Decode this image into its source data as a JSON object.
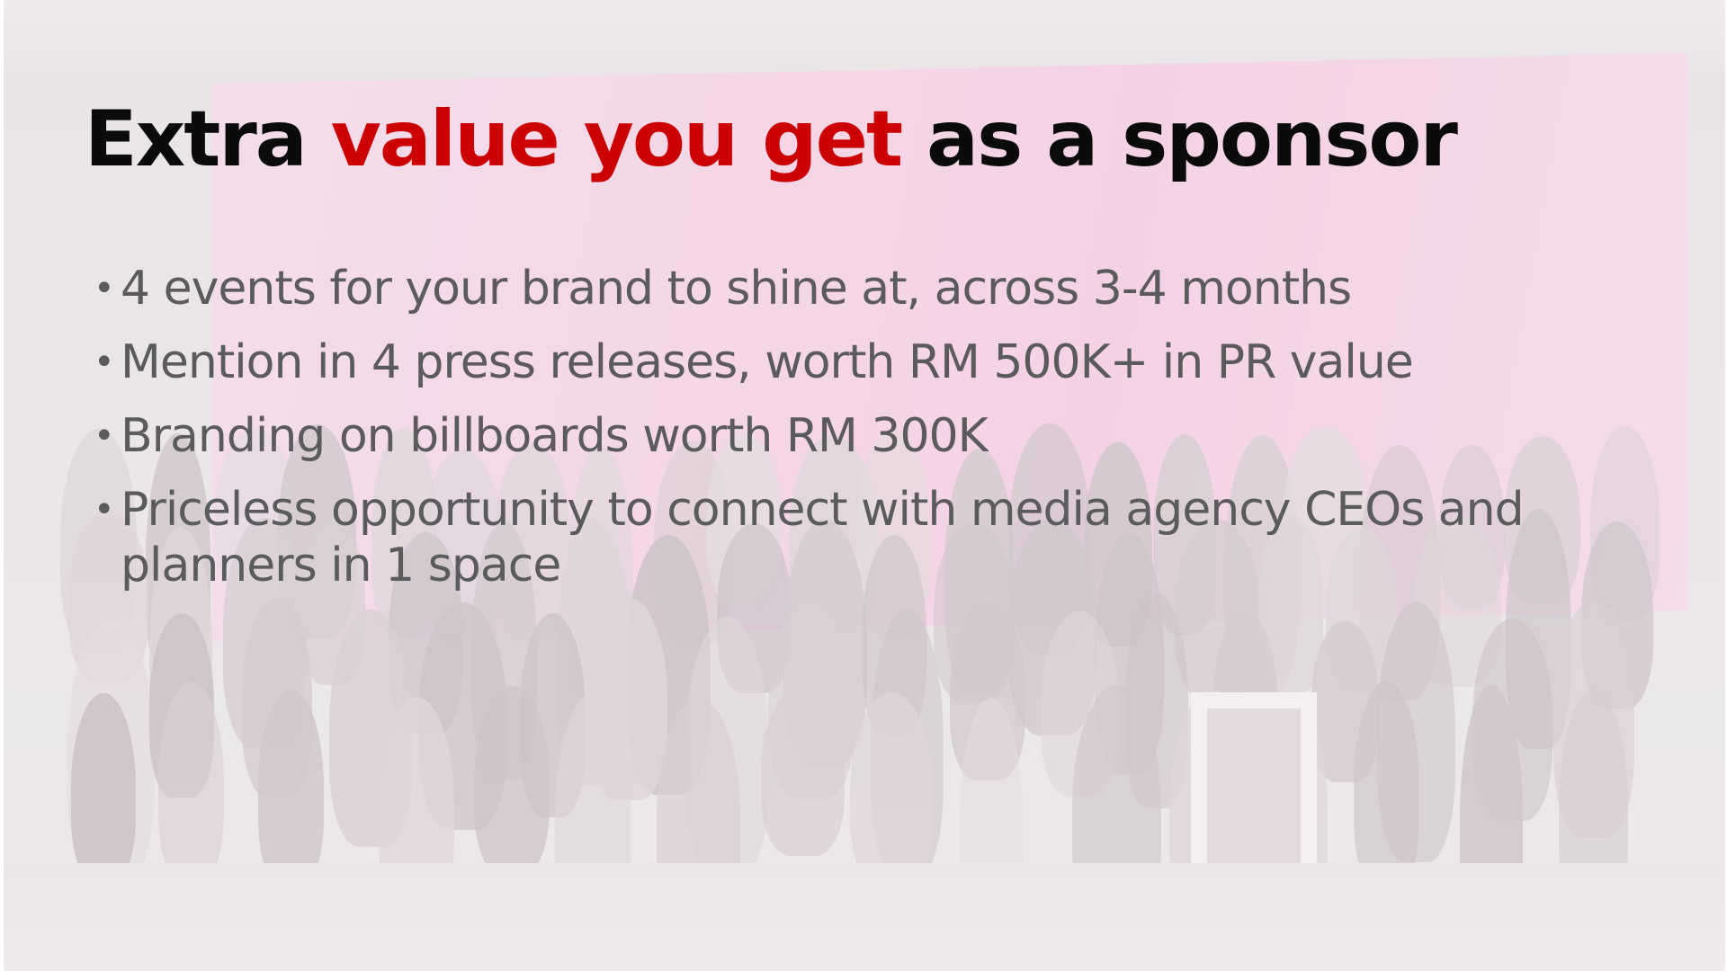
{
  "slide": {
    "title": {
      "part1": "Extra ",
      "accent": "value you get",
      "part2": " as a sponsor"
    },
    "bullets": [
      "4 events for your brand to shine at, across 3-4 months",
      "Mention in 4 press releases, worth RM 500K+ in PR value",
      "Branding on billboards worth RM 300K",
      "Priceless opportunity to connect with media agency CEOs and planners in 1 space"
    ],
    "bullet_glyph": "•"
  },
  "colors": {
    "title": "#0b0b0b",
    "accent": "#cc0000",
    "body_text": "#5b5b5d",
    "stage_pink": "#f3aed6"
  }
}
